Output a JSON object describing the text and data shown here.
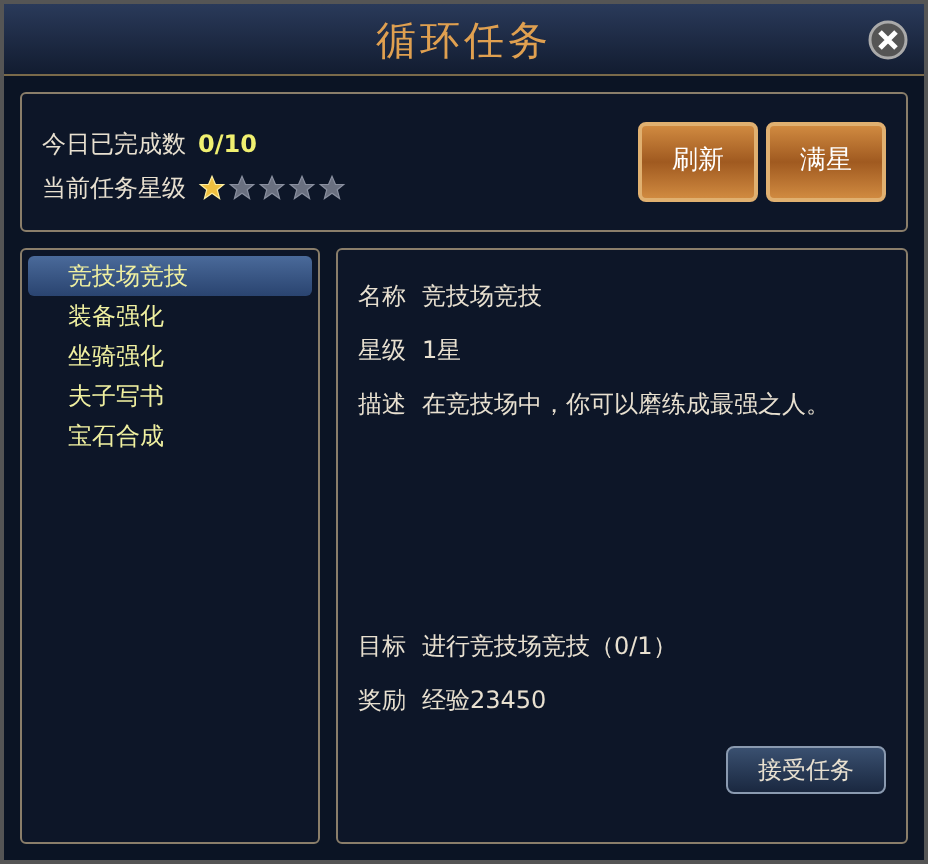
{
  "window": {
    "title": "循环任务"
  },
  "summary": {
    "completed_label": "今日已完成数",
    "completed_value": "0/10",
    "star_label": "当前任务星级",
    "stars": 1
  },
  "buttons": [
    "刷新",
    "满星"
  ],
  "tasks": [
    {
      "label": "竞技场竞技",
      "selected": true
    },
    {
      "label": "装备强化",
      "selected": false
    },
    {
      "label": "坐骑强化",
      "selected": false
    },
    {
      "label": "夫子写书",
      "selected": false
    },
    {
      "label": "宝石合成",
      "selected": false
    }
  ],
  "info": [
    {
      "label": "名称",
      "value": "竞技场竞技"
    },
    {
      "label": "星级",
      "value": "1星"
    },
    {
      "label": "描述",
      "value": "在竞技场中，你可以磨练成最强之人。"
    }
  ],
  "goal": [
    {
      "label": "目标",
      "value": "进行竞技场竞技（0/1）"
    },
    {
      "label": "奖励",
      "value": "经验23450"
    }
  ],
  "accept_button": "接受任务"
}
